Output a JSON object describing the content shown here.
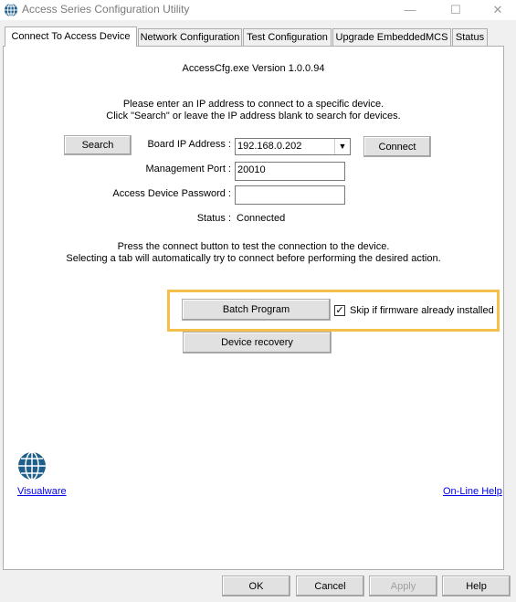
{
  "window": {
    "title": "Access Series Configuration Utility"
  },
  "tabs": [
    {
      "label": "Connect To Access Device"
    },
    {
      "label": "Network Configuration"
    },
    {
      "label": "Test Configuration"
    },
    {
      "label": "Upgrade EmbeddedMCS"
    },
    {
      "label": "Status"
    }
  ],
  "connect": {
    "version": "AccessCfg.exe Version 1.0.0.94",
    "instructions_line1": "Please enter an IP address to connect to a specific device.",
    "instructions_line2": "Click \"Search\" or leave the IP address blank to search for devices.",
    "search_button": "Search",
    "board_ip_label": "Board IP Address :",
    "board_ip_value": "192.168.0.202",
    "connect_button": "Connect",
    "mgmt_port_label": "Management Port :",
    "mgmt_port_value": "20010",
    "password_label": "Access Device Password :",
    "password_value": "",
    "status_label": "Status :",
    "status_value": "Connected",
    "note_line1": "Press the connect button to test the connection to the device.",
    "note_line2": "Selecting a tab will automatically try to connect before performing the desired action.",
    "batch_program_button": "Batch Program",
    "skip_checkbox_label": "Skip if firmware already installed",
    "skip_checked": true,
    "device_recovery_button": "Device recovery",
    "visualware_link": "Visualware",
    "online_help_link": "On-Line Help"
  },
  "footer": {
    "ok": "OK",
    "cancel": "Cancel",
    "apply": "Apply",
    "help": "Help"
  },
  "colors": {
    "highlight": "#f4c04a",
    "link": "#0000ee",
    "logo": "#1f5f8b"
  }
}
